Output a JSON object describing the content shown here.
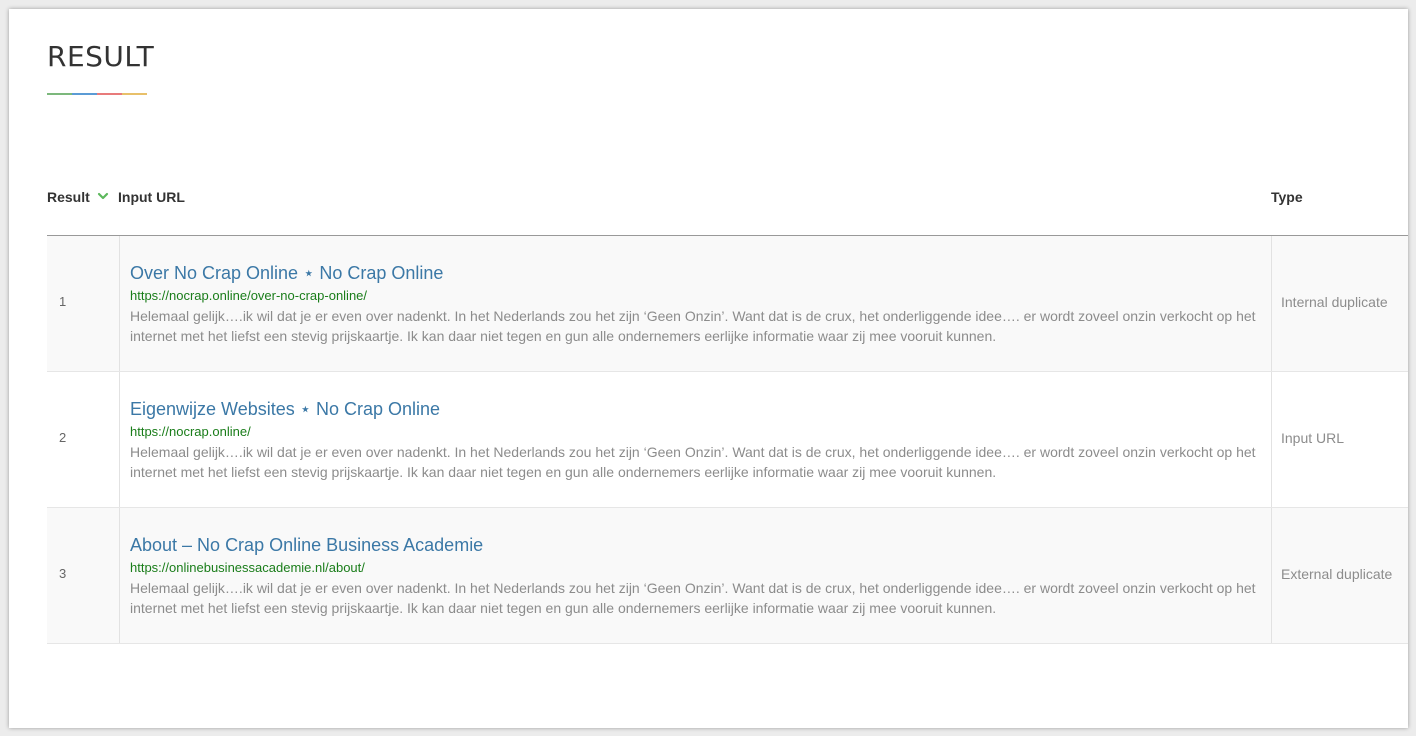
{
  "page": {
    "title": "RESULT",
    "underline_colors": [
      "#7cb87c",
      "#5b9bd5",
      "#e87b7b",
      "#e8c06a"
    ]
  },
  "table": {
    "headers": {
      "result": "Result",
      "input_url": "Input URL",
      "type": "Type"
    },
    "sort_icon": "chevron-down-icon",
    "sort_icon_color": "#5cb85c",
    "rows": [
      {
        "num": "1",
        "title": "Over No Crap Online ⋆ No Crap Online",
        "url": "https://nocrap.online/over-no-crap-online/",
        "description": "Helemaal gelijk….ik wil dat je er even over nadenkt. In het Nederlands zou het zijn ‘Geen Onzin’. Want dat is de crux, het onderliggende idee…. er wordt zoveel onzin verkocht op het internet met het liefst een stevig prijskaartje. Ik kan daar niet tegen en gun alle ondernemers eerlijke informatie waar zij mee vooruit kunnen.",
        "type": "Internal duplicate"
      },
      {
        "num": "2",
        "title": "Eigenwijze Websites ⋆ No Crap Online",
        "url": "https://nocrap.online/",
        "description": "Helemaal gelijk….ik wil dat je er even over nadenkt. In het Nederlands zou het zijn ‘Geen Onzin’. Want dat is de crux, het onderliggende idee…. er wordt zoveel onzin verkocht op het internet met het liefst een stevig prijskaartje. Ik kan daar niet tegen en gun alle ondernemers eerlijke informatie waar zij mee vooruit kunnen.",
        "type": "Input URL"
      },
      {
        "num": "3",
        "title": "About – No Crap Online Business Academie",
        "url": "https://onlinebusinessacademie.nl/about/",
        "description": "Helemaal gelijk….ik wil dat je er even over nadenkt. In het Nederlands zou het zijn ‘Geen Onzin’. Want dat is de crux, het onderliggende idee…. er wordt zoveel onzin verkocht op het internet met het liefst een stevig prijskaartje. Ik kan daar niet tegen en gun alle ondernemers eerlijke informatie waar zij mee vooruit kunnen.",
        "type": "External duplicate"
      }
    ]
  }
}
